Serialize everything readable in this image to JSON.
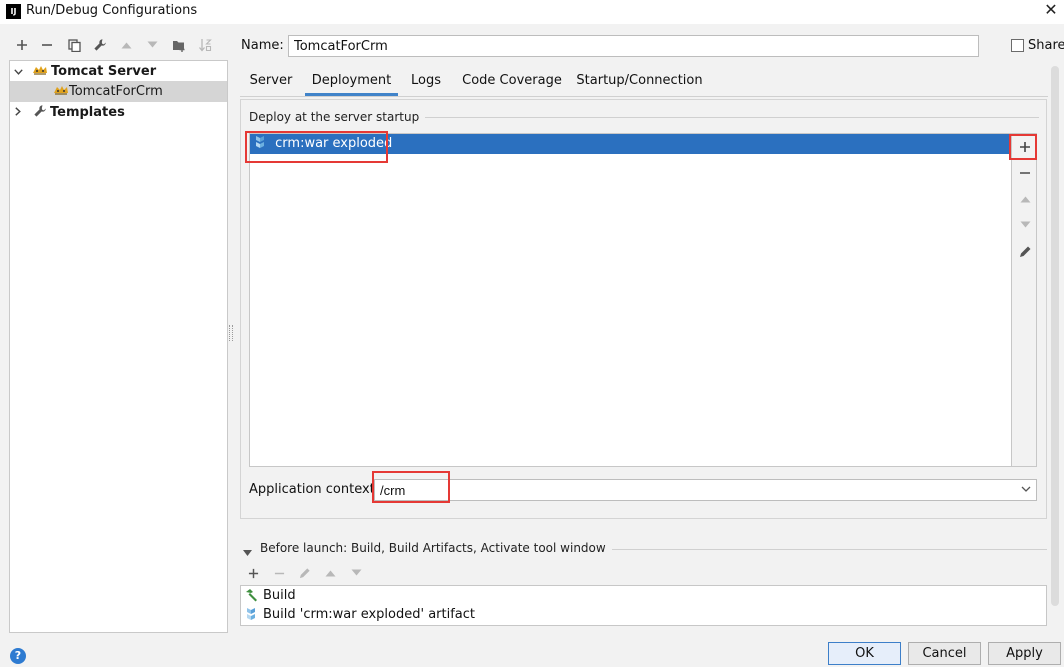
{
  "window": {
    "title": "Run/Debug Configurations",
    "app_icon_text": "IJ",
    "close_glyph": "✕"
  },
  "toolbar": {
    "icons": [
      "add-icon",
      "remove-icon",
      "copy-icon",
      "wrench-icon",
      "move-up-icon",
      "move-down-icon",
      "folder-icon",
      "sort-icon"
    ]
  },
  "tree": {
    "items": [
      {
        "label": "Tomcat Server",
        "expanded": true,
        "bold": true
      },
      {
        "label": "TomcatForCrm",
        "selected": true
      },
      {
        "label": "Templates",
        "expanded": false,
        "bold": true
      }
    ]
  },
  "form": {
    "name_label": "Name:",
    "name_value": "TomcatForCrm",
    "share_label": "Share",
    "share_checked": false
  },
  "tabs": [
    {
      "label": "Server"
    },
    {
      "label": "Deployment",
      "active": true
    },
    {
      "label": "Logs"
    },
    {
      "label": "Code Coverage"
    },
    {
      "label": "Startup/Connection"
    }
  ],
  "deployment": {
    "section_label": "Deploy at the server startup",
    "artifacts": [
      {
        "label": "crm:war exploded",
        "selected": true
      }
    ],
    "side_tools": [
      "add-icon",
      "remove-icon",
      "move-up-icon",
      "move-down-icon",
      "edit-icon"
    ],
    "context_label": "Application context:",
    "context_value": "/crm"
  },
  "before_launch": {
    "header": "Before launch: Build, Build Artifacts, Activate tool window",
    "items": [
      {
        "label": "Build",
        "icon": "hammer-icon"
      },
      {
        "label": "Build 'crm:war exploded' artifact",
        "icon": "artifact-icon"
      }
    ]
  },
  "buttons": {
    "ok": "OK",
    "cancel": "Cancel",
    "apply": "Apply",
    "help": "?"
  },
  "colors": {
    "accent": "#2b70bf",
    "tab_underline": "#4083c9",
    "highlight_box": "#e53935"
  }
}
